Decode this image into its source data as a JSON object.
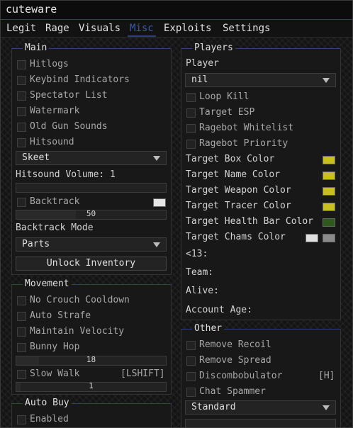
{
  "app": {
    "title": "cuteware"
  },
  "tabs": [
    {
      "label": "Legit",
      "active": false
    },
    {
      "label": "Rage",
      "active": false
    },
    {
      "label": "Visuals",
      "active": false
    },
    {
      "label": "Misc",
      "active": true
    },
    {
      "label": "Exploits",
      "active": false
    },
    {
      "label": "Settings",
      "active": false
    }
  ],
  "main": {
    "title": "Main",
    "checkboxes": [
      "Hitlogs",
      "Keybind Indicators",
      "Spectator List",
      "Watermark",
      "Old Gun Sounds",
      "Hitsound"
    ],
    "hitsound_combo": "Skeet",
    "hitsound_volume_label": "Hitsound Volume: 1",
    "hitsound_volume_fraction": 0,
    "backtrack_label": "Backtrack",
    "backtrack_color": "#e6e6e6",
    "backtrack_slider_value": "50",
    "backtrack_mode_label": "Backtrack Mode",
    "backtrack_mode_value": "Parts",
    "unlock_inventory": "Unlock Inventory"
  },
  "movement": {
    "title": "Movement",
    "checkboxes": [
      "No Crouch Cooldown",
      "Auto Strafe",
      "Maintain Velocity",
      "Bunny Hop"
    ],
    "bhop_slider_value": "18",
    "slow_walk_label": "Slow Walk",
    "slow_walk_key": "[LSHIFT]",
    "slow_walk_slider_value": "1"
  },
  "auto_buy": {
    "title": "Auto Buy",
    "enabled_label": "Enabled"
  },
  "players": {
    "title": "Players",
    "player_label": "Player",
    "player_value": "nil",
    "checkboxes": [
      "Loop Kill",
      "Target ESP",
      "Ragebot Whitelist",
      "Ragebot Priority"
    ],
    "colors": [
      {
        "label": "Target Box Color",
        "swatches": [
          "#c8c020"
        ]
      },
      {
        "label": "Target Name Color",
        "swatches": [
          "#c8c020"
        ]
      },
      {
        "label": "Target Weapon Color",
        "swatches": [
          "#c8c020"
        ]
      },
      {
        "label": "Target Tracer Color",
        "swatches": [
          "#c8c020"
        ]
      },
      {
        "label": "Target Health Bar Color",
        "swatches": [
          "#2e5a1e"
        ]
      },
      {
        "label": "Target Chams Color",
        "swatches": [
          "#e0e0e0",
          "#8a8a8a"
        ]
      }
    ],
    "info": [
      "<13:",
      "Team:",
      "Alive:",
      "Account Age:"
    ]
  },
  "other": {
    "title": "Other",
    "checkboxes": [
      "Remove Recoil",
      "Remove Spread",
      "Discombobulator",
      "Chat Spammer"
    ],
    "discombobulator_key": "[H]",
    "spammer_value": "Standard"
  },
  "theme": {
    "accent": "#2f3f7c",
    "active_tab_text": "#3f5a9e",
    "checkbox_bg": "#222222",
    "panel_bg": "#181818"
  }
}
